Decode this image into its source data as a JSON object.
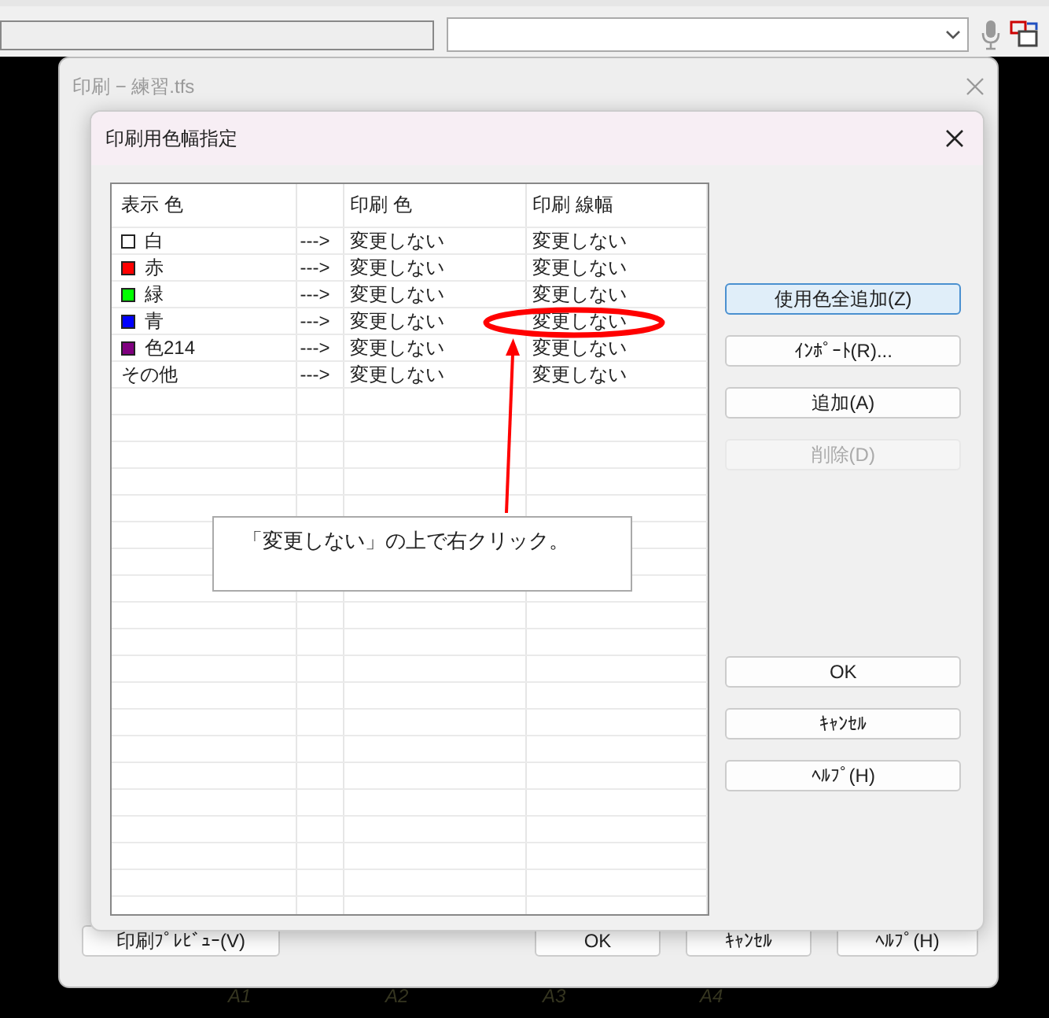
{
  "outer_window": {
    "title": "印刷 − 練習.tfs",
    "buttons": [
      {
        "label": "印刷ﾌﾟﾚﾋﾞｭｰ(V)"
      },
      {
        "label": "OK"
      },
      {
        "label": "ｷｬﾝｾﾙ"
      },
      {
        "label": "ﾍﾙﾌﾟ(H)"
      }
    ]
  },
  "dialog": {
    "title": "印刷用色幅指定",
    "table": {
      "columns": [
        "表示 色",
        "印刷 色",
        "印刷 線幅"
      ],
      "rows": [
        {
          "color": "#ffffff",
          "name": "白",
          "arrow": "--->",
          "print_color": "変更しない",
          "print_width": "変更しない"
        },
        {
          "color": "#ff0000",
          "name": "赤",
          "arrow": "--->",
          "print_color": "変更しない",
          "print_width": "変更しない"
        },
        {
          "color": "#00ff00",
          "name": "緑",
          "arrow": "--->",
          "print_color": "変更しない",
          "print_width": "変更しない"
        },
        {
          "color": "#0000ff",
          "name": "青",
          "arrow": "--->",
          "print_color": "変更しない",
          "print_width": "変更しない"
        },
        {
          "color": "#800080",
          "name": "色214",
          "arrow": "--->",
          "print_color": "変更しない",
          "print_width": "変更しない"
        },
        {
          "name": "その他",
          "arrow": "--->",
          "print_color": "変更しない",
          "print_width": "変更しない"
        }
      ]
    },
    "buttons": [
      {
        "label": "使用色全追加(Z)",
        "focused": true,
        "disabled": false
      },
      {
        "label": "ｲﾝﾎﾟｰﾄ(R)...",
        "focused": false,
        "disabled": false
      },
      {
        "label": "追加(A)",
        "focused": false,
        "disabled": false
      },
      {
        "label": "削除(D)",
        "focused": false,
        "disabled": true
      }
    ],
    "action_buttons": [
      {
        "label": "OK"
      },
      {
        "label": "ｷｬﾝｾﾙ"
      },
      {
        "label": "ﾍﾙﾌﾟ(H)"
      }
    ]
  },
  "annotation": {
    "callout": "「変更しない」の上で右クリック。"
  },
  "background_labels": [
    "A1",
    "A2",
    "A3",
    "A4"
  ]
}
